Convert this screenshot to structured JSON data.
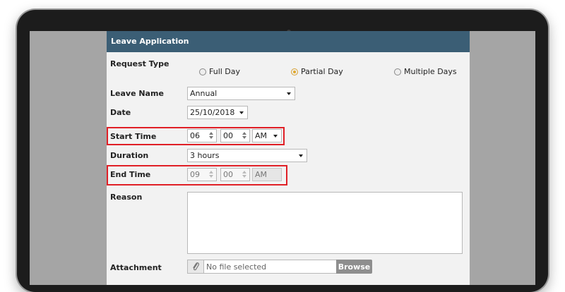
{
  "panel": {
    "title": "Leave Application"
  },
  "request_type": {
    "label": "Request Type",
    "options": [
      {
        "label": "Full Day",
        "checked": false
      },
      {
        "label": "Partial Day",
        "checked": true
      },
      {
        "label": "Multiple Days",
        "checked": false
      }
    ]
  },
  "leave_name": {
    "label": "Leave Name",
    "value": "Annual"
  },
  "date": {
    "label": "Date",
    "value": "25/10/2018"
  },
  "start_time": {
    "label": "Start Time",
    "hour": "06",
    "minute": "00",
    "ampm": "AM"
  },
  "duration": {
    "label": "Duration",
    "value": "3 hours"
  },
  "end_time": {
    "label": "End Time",
    "hour": "09",
    "minute": "00",
    "ampm": "AM"
  },
  "reason": {
    "label": "Reason",
    "value": ""
  },
  "attachment": {
    "label": "Attachment",
    "placeholder": "No file selected",
    "browse_label": "Browse"
  },
  "colors": {
    "header": "#3b5e75",
    "highlight": "#e01f26",
    "radio_checked": "#e0a82e"
  },
  "icons": {
    "attachment": "paperclip-icon"
  }
}
